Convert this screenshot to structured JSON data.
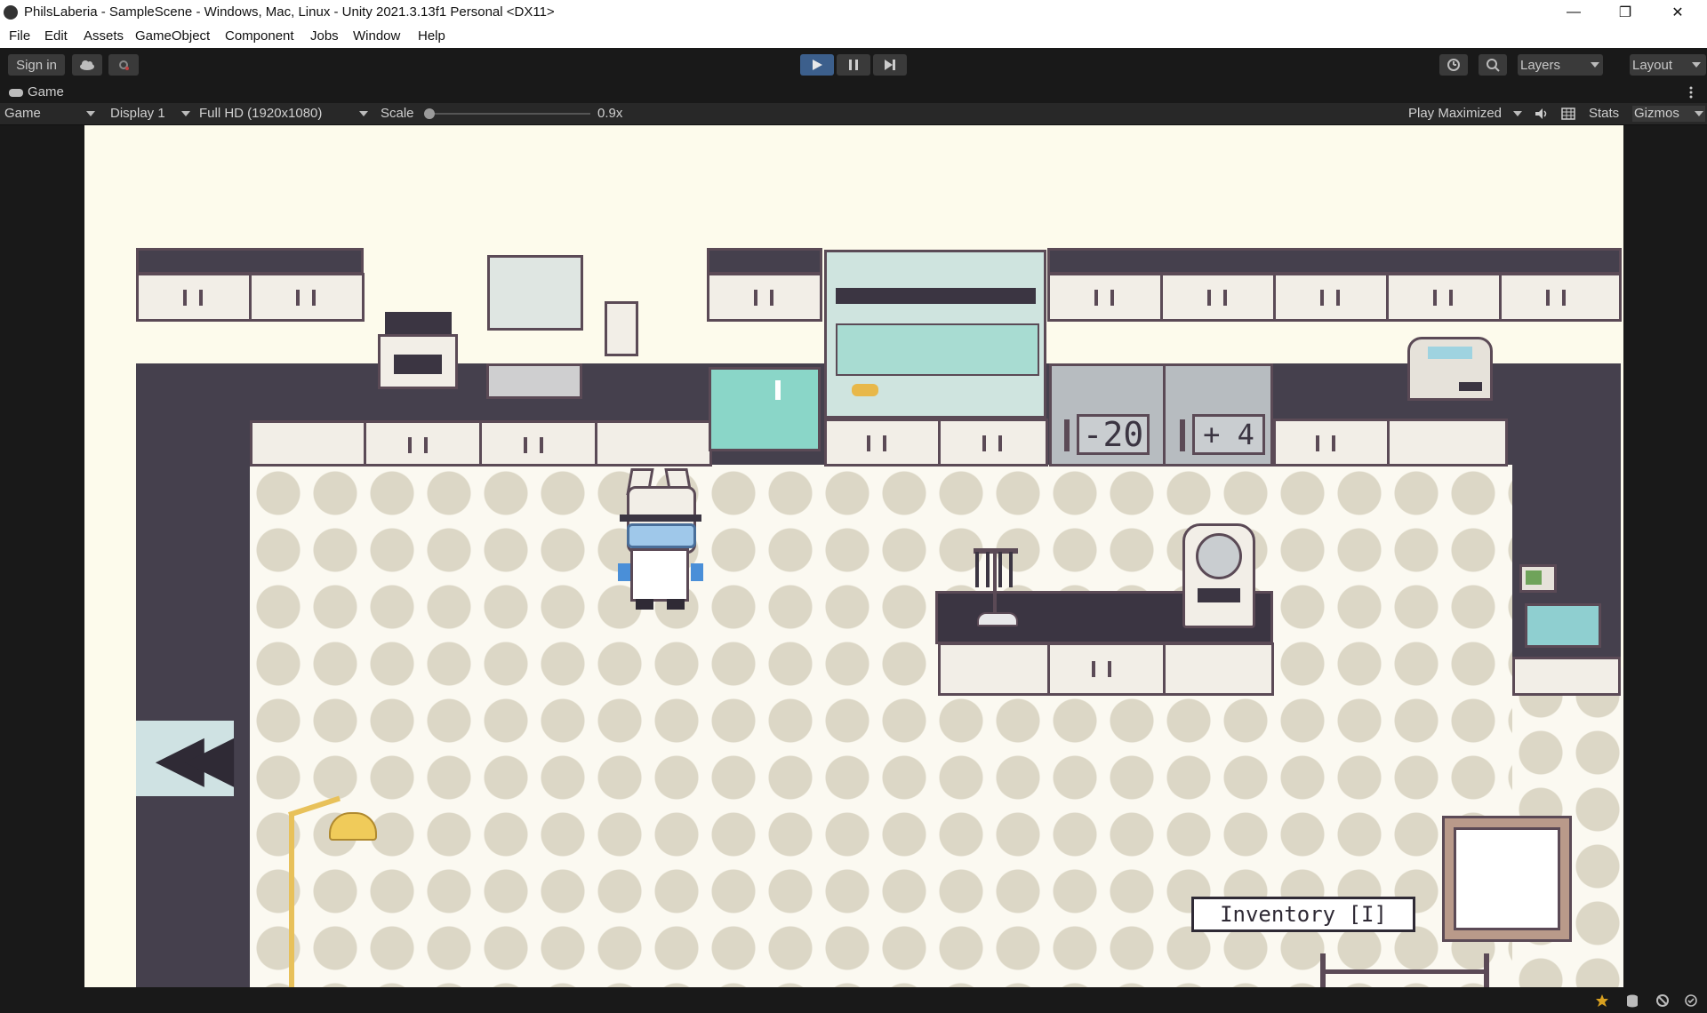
{
  "window": {
    "title": "PhilsLaberia - SampleScene - Windows, Mac, Linux - Unity 2021.3.13f1 Personal <DX11>",
    "minimize": "—",
    "maximize": "❐",
    "close": "✕"
  },
  "menu": [
    "File",
    "Edit",
    "Assets",
    "GameObject",
    "Component",
    "Jobs",
    "Window",
    "Help"
  ],
  "toolbar": {
    "sign_in": "Sign in",
    "layers": "Layers",
    "layout": "Layout",
    "play_icon": "play-icon",
    "pause_icon": "pause-icon",
    "step_icon": "step-icon"
  },
  "tab": {
    "label": "Game"
  },
  "gamebar": {
    "view": "Game",
    "display": "Display 1",
    "resolution": "Full HD (1920x1080)",
    "scale_label": "Scale",
    "scale_value": "0.9x",
    "play_mode": "Play Maximized",
    "stats": "Stats",
    "gizmos": "Gizmos"
  },
  "game": {
    "freezer_left": "-20",
    "freezer_right": "+ 4",
    "inventory_label": "Inventory [I]",
    "back_arrows": "◀◀"
  },
  "colors": {
    "editor_bg": "#191919",
    "game_bg": "#fdfbec",
    "wall_dark": "#45404d",
    "cabinet": "#f2eee7",
    "outline": "#5b4a56",
    "play_active": "#3c5f8c"
  }
}
